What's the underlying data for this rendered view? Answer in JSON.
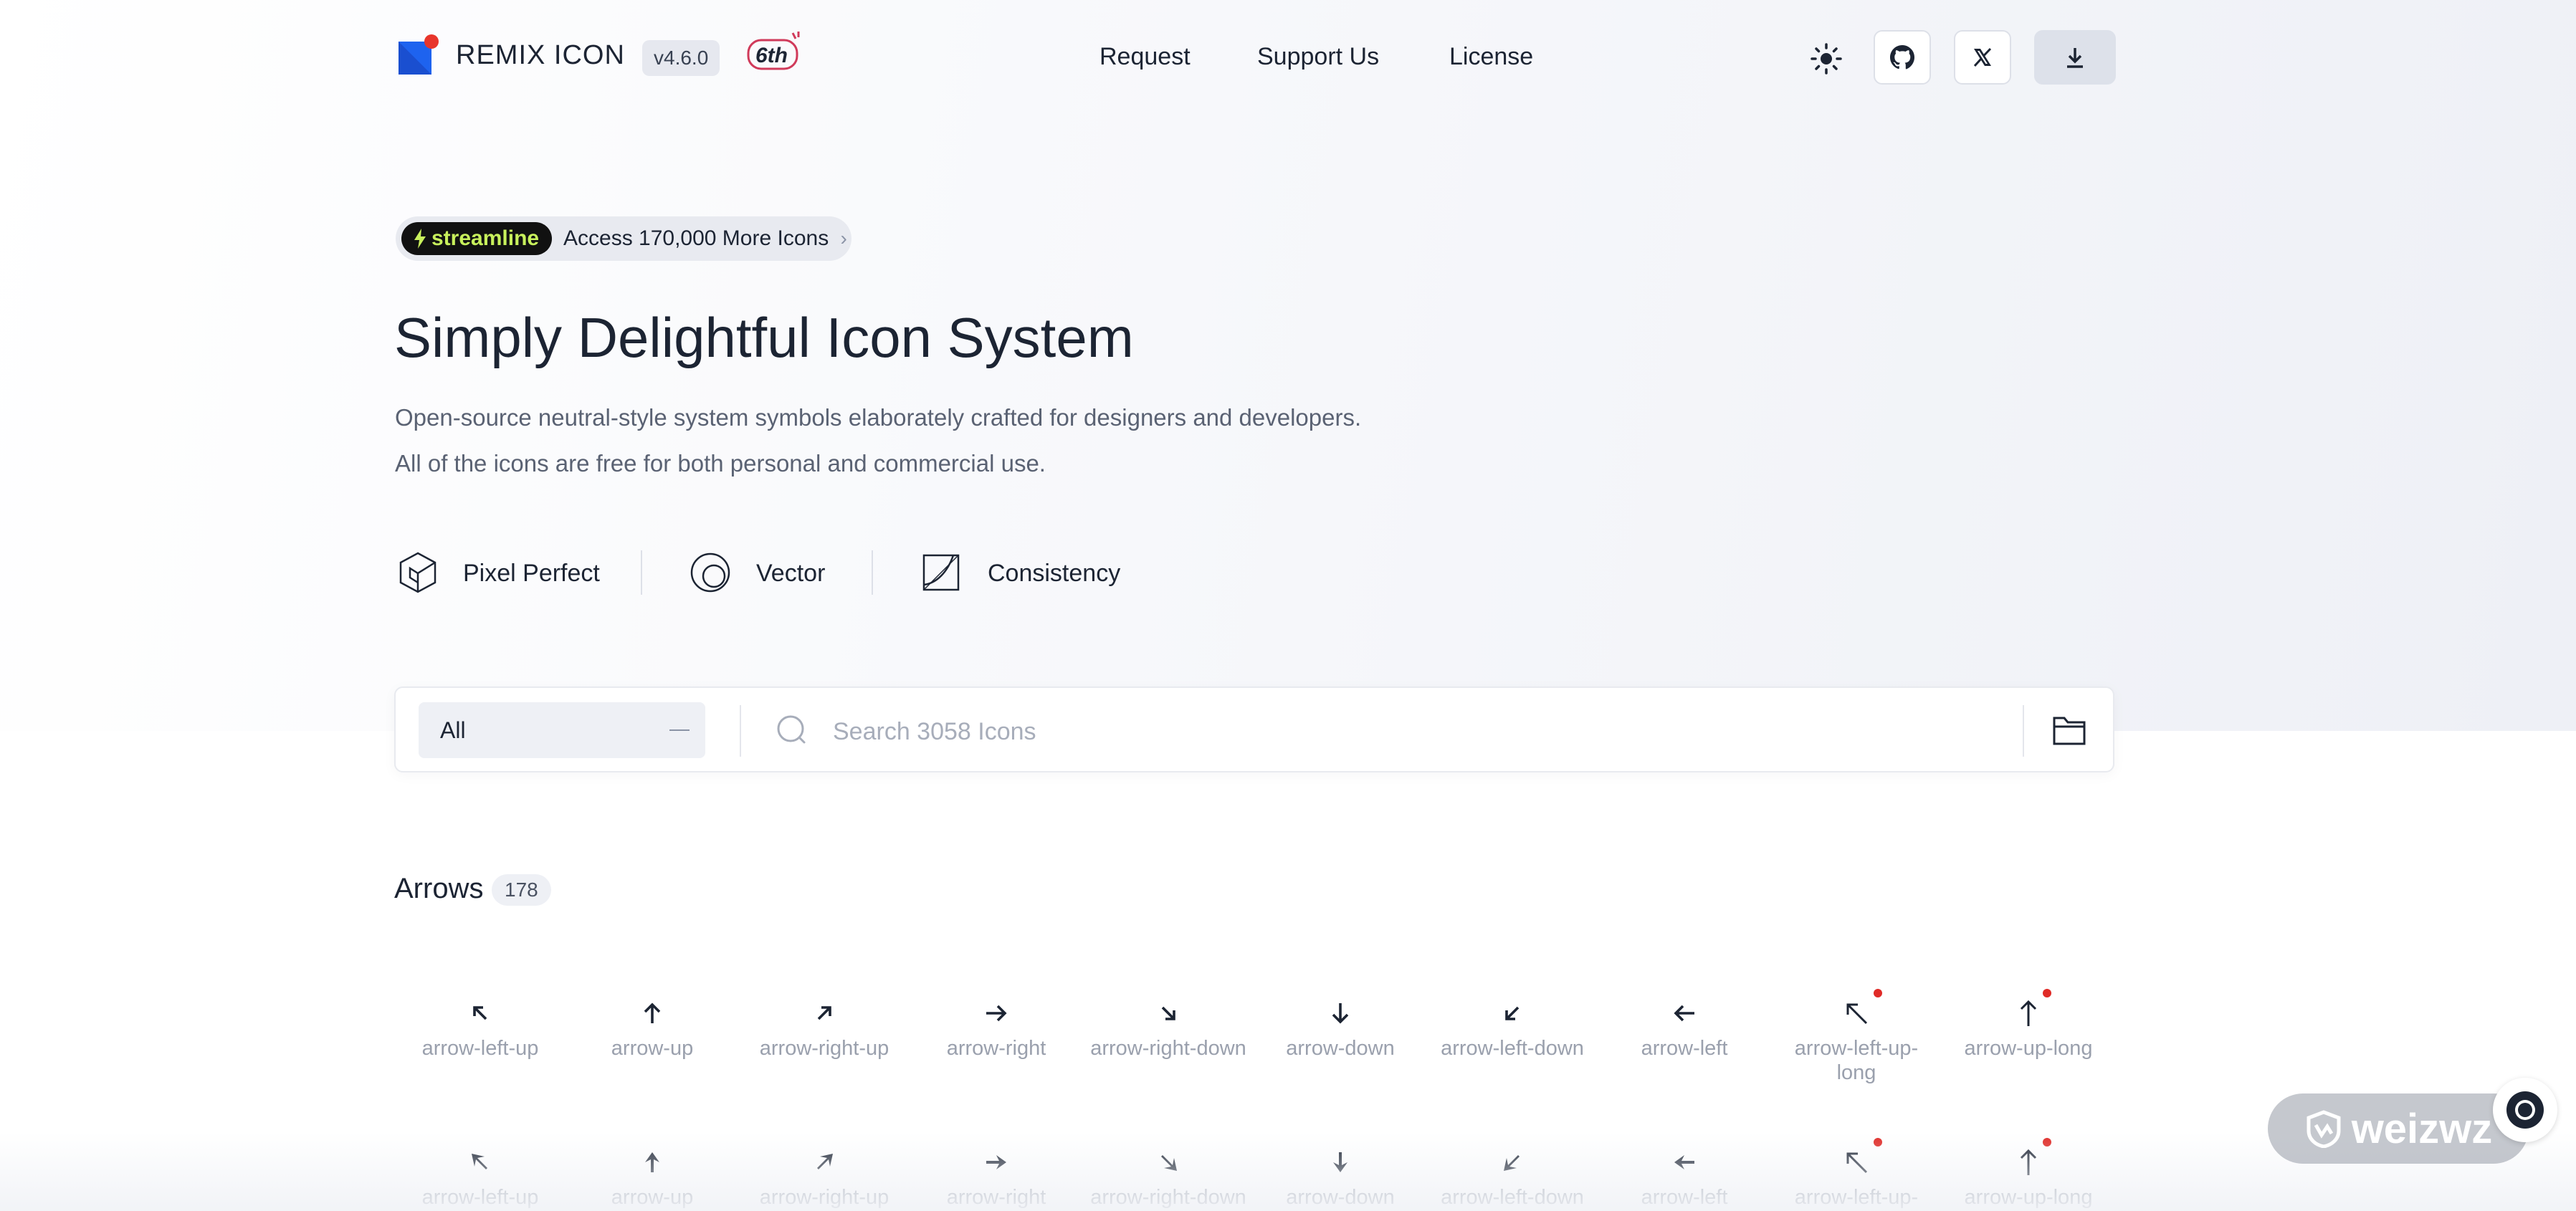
{
  "header": {
    "brand": "REMIX ICON",
    "version": "v4.6.0",
    "anniversary": "6th",
    "nav": [
      "Request",
      "Support Us",
      "License"
    ]
  },
  "promo": {
    "tag": "streamline",
    "text": "Access 170,000 More Icons"
  },
  "hero": {
    "title": "Simply Delightful Icon System",
    "desc_line1": "Open-source neutral-style system symbols elaborately crafted for designers and developers.",
    "desc_line2": "All of the icons are free for both personal and commercial use.",
    "features": [
      "Pixel Perfect",
      "Vector",
      "Consistency"
    ]
  },
  "search": {
    "category": "All",
    "placeholder": "Search 3058 Icons"
  },
  "section": {
    "title": "Arrows",
    "count": "178",
    "row1": [
      {
        "label": "arrow-left-up",
        "icon": "arrow-left-up-icon"
      },
      {
        "label": "arrow-up",
        "icon": "arrow-up-icon"
      },
      {
        "label": "arrow-right-up",
        "icon": "arrow-right-up-icon"
      },
      {
        "label": "arrow-right",
        "icon": "arrow-right-icon"
      },
      {
        "label": "arrow-right-down",
        "icon": "arrow-right-down-icon"
      },
      {
        "label": "arrow-down",
        "icon": "arrow-down-icon"
      },
      {
        "label": "arrow-left-down",
        "icon": "arrow-left-down-icon"
      },
      {
        "label": "arrow-left",
        "icon": "arrow-left-icon"
      },
      {
        "label": "arrow-left-up-long",
        "icon": "arrow-left-up-long-icon",
        "new": true
      },
      {
        "label": "arrow-up-long",
        "icon": "arrow-up-long-icon",
        "new": true
      }
    ],
    "row2": [
      {
        "label": "arrow-left-up",
        "icon": "arrow-left-up-fill-icon"
      },
      {
        "label": "arrow-up",
        "icon": "arrow-up-fill-icon"
      },
      {
        "label": "arrow-right-up",
        "icon": "arrow-right-up-fill-icon"
      },
      {
        "label": "arrow-right",
        "icon": "arrow-right-fill-icon"
      },
      {
        "label": "arrow-right-down",
        "icon": "arrow-right-down-fill-icon"
      },
      {
        "label": "arrow-down",
        "icon": "arrow-down-fill-icon"
      },
      {
        "label": "arrow-left-down",
        "icon": "arrow-left-down-fill-icon"
      },
      {
        "label": "arrow-left",
        "icon": "arrow-left-fill-icon"
      },
      {
        "label": "arrow-left-up-",
        "icon": "arrow-left-up-long-fill-icon",
        "new": true
      },
      {
        "label": "arrow-up-long",
        "icon": "arrow-up-long-fill-icon",
        "new": true
      }
    ]
  },
  "watermark": "weizwz",
  "colors": {
    "accent": "#0070f3",
    "new_dot": "#e02b27",
    "promo_green": "#c8f05c"
  }
}
